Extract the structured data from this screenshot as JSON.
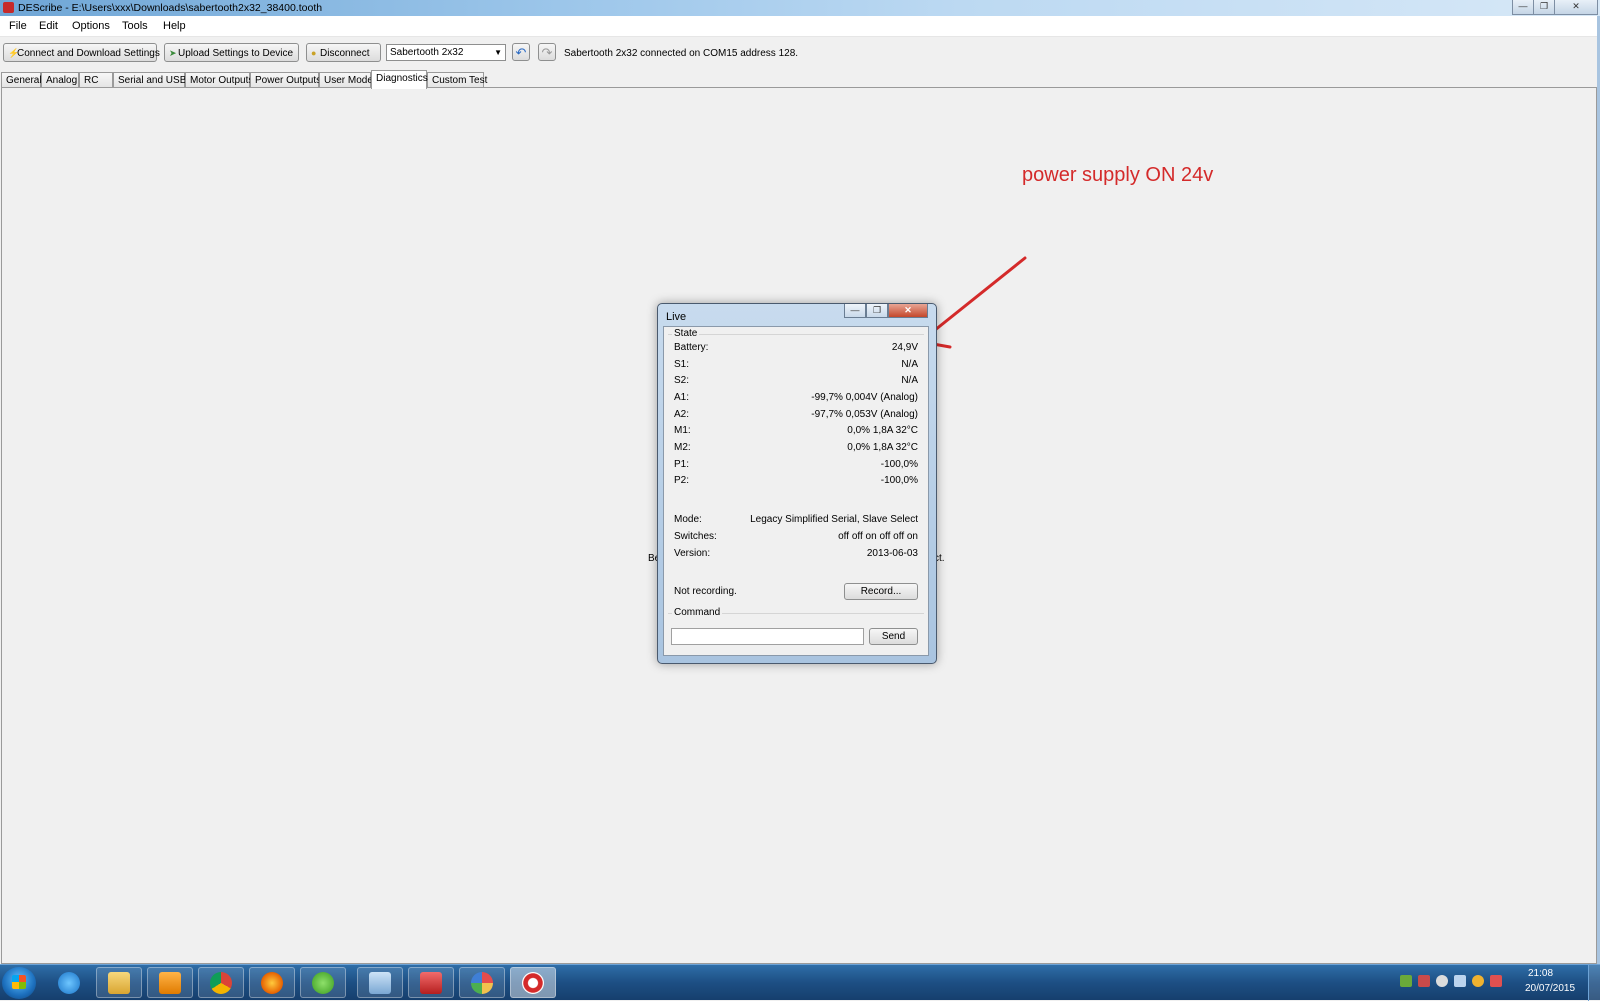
{
  "window": {
    "title": "DEScribe - E:\\Users\\xxx\\Downloads\\sabertooth2x32_38400.tooth",
    "min_glyph": "—",
    "max_glyph": "❐",
    "close_glyph": "✕"
  },
  "menu": [
    "File",
    "Edit",
    "Options",
    "Tools",
    "Help"
  ],
  "toolbar": {
    "connect_label": "Connect and Download Settings",
    "upload_label": "Upload Settings to Device",
    "disconnect_label": "Disconnect",
    "device_selected": "Sabertooth 2x32",
    "undo_glyph": "↶",
    "redo_glyph": "↷",
    "status": "Sabertooth 2x32 connected on COM15 address 128."
  },
  "tabs": [
    "General",
    "Analog",
    "RC",
    "Serial and USB",
    "Motor Outputs",
    "Power Outputs",
    "User Mode",
    "Diagnostics",
    "Custom Test"
  ],
  "background_text": {
    "left": "Be",
    "right": "ct."
  },
  "annotation": {
    "text": "power supply ON 24v",
    "color": "#d42a2a"
  },
  "live": {
    "title": "Live",
    "state_label": "State",
    "rows": [
      {
        "label": "Battery:",
        "value": "24,9V"
      },
      {
        "label": "S1:",
        "value": "N/A"
      },
      {
        "label": "S2:",
        "value": "N/A"
      },
      {
        "label": "A1:",
        "value": "-99,7% 0,004V  (Analog)"
      },
      {
        "label": "A2:",
        "value": "-97,7% 0,053V  (Analog)"
      },
      {
        "label": "M1:",
        "value": "0,0% 1,8A 32°C"
      },
      {
        "label": "M2:",
        "value": "0,0% 1,8A 32°C"
      },
      {
        "label": "P1:",
        "value": "-100,0%"
      },
      {
        "label": "P2:",
        "value": "-100,0%"
      }
    ],
    "info": [
      {
        "label": "Mode:",
        "value": "Legacy Simplified Serial, Slave Select"
      },
      {
        "label": "Switches:",
        "value": "off off on off off on"
      },
      {
        "label": "Version:",
        "value": "2013-06-03"
      }
    ],
    "recording_status": "Not recording.",
    "record_label": "Record...",
    "command_label": "Command",
    "command_value": "",
    "send_label": "Send"
  },
  "taskbar": {
    "apps": [
      "windows-explorer",
      "media-player",
      "chrome",
      "firefox",
      "utorrent",
      "control-panel",
      "toolbox",
      "paint",
      "describe"
    ],
    "time": "21:08",
    "date": "20/07/2015"
  }
}
